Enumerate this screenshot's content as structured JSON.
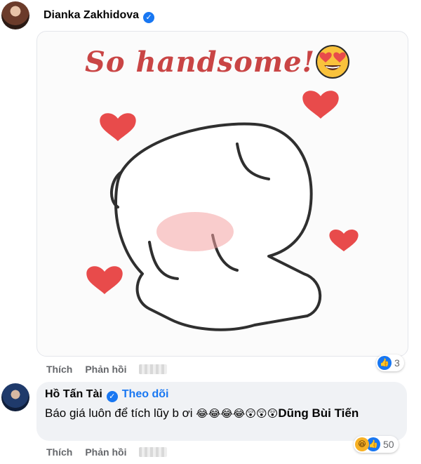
{
  "comment1": {
    "author": "Dianka Zakhidova",
    "sticker_text": "So handsome!",
    "actions": {
      "like": "Thích",
      "reply": "Phản hồi"
    },
    "reaction_count": "3"
  },
  "comment2": {
    "author": "Hồ Tấn Tài",
    "follow_label": "Theo dõi",
    "text": "Báo giá luôn để tích lũy b ơi",
    "emojis": "😂😂😂😂😲😲😲",
    "mention": "Dũng Bùi Tiến",
    "actions": {
      "like": "Thích",
      "reply": "Phản hồi"
    },
    "reaction_count": "50"
  },
  "colors": {
    "accent": "#1877f2",
    "sticker_text": "#c94545",
    "heart": "#e84b4b",
    "bubble_bg": "#f0f2f5",
    "muted": "#65676b"
  },
  "icons": [
    "verified-badge-icon",
    "heart-eyes-emoji-icon",
    "like-reaction-icon",
    "haha-reaction-icon"
  ]
}
